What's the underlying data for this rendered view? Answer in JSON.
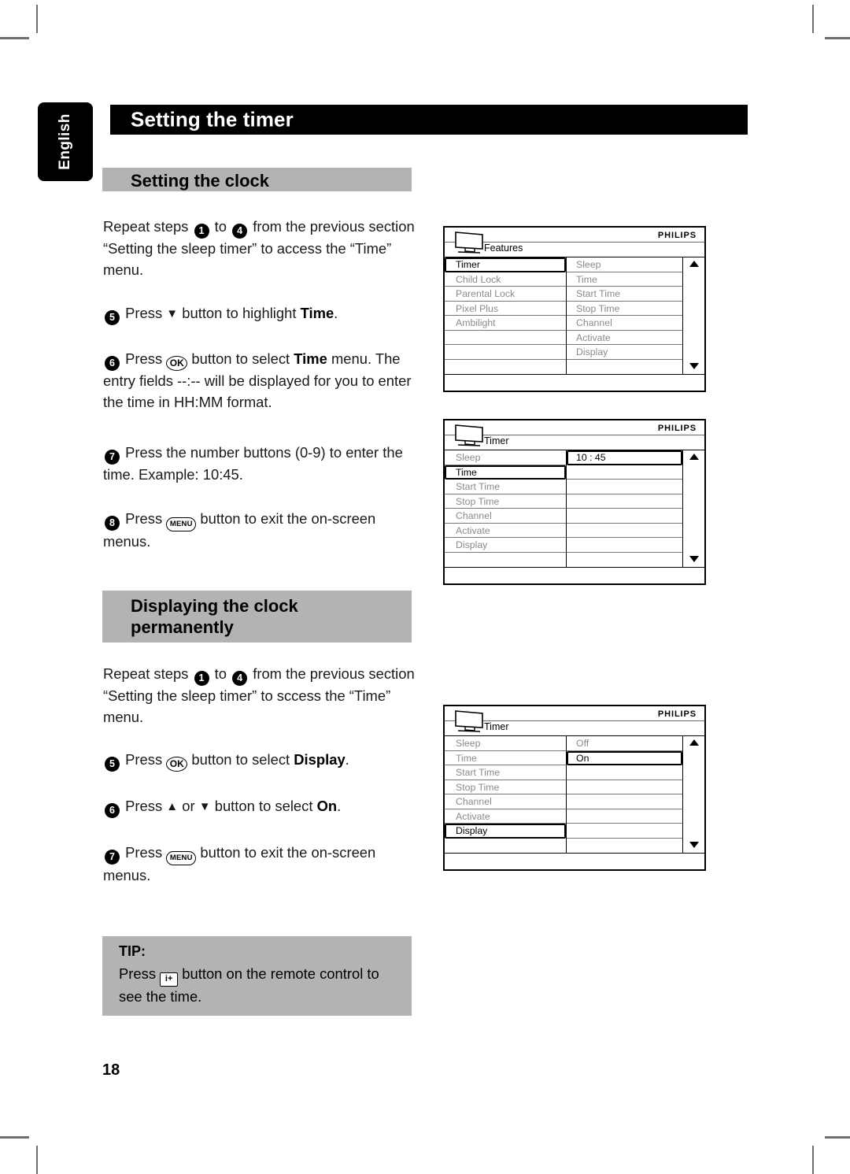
{
  "page": {
    "number": "18",
    "language_tab": "English",
    "chapter_title": "Setting the timer"
  },
  "sections": [
    {
      "heading": "Setting the clock",
      "paragraphs": [
        {
          "id": "p1",
          "text_pre": "Repeat steps",
          "step_a": "1",
          "mid": "to",
          "step_b": "4",
          "text_post": "from the previous section “Setting the sleep timer” to access the “Time” menu."
        },
        {
          "id": "p2",
          "step": "5",
          "pre": "Press",
          "glyph": "▼",
          "mid": "button to highlight",
          "bold": "Time",
          "post": "."
        },
        {
          "id": "p3",
          "step": "6",
          "pre": "Press",
          "glyph": "OK",
          "mid": "button to select",
          "bold": "Time",
          "post": " menu. The entry fields --:-- will be displayed for you to enter the time in HH:MM format."
        },
        {
          "id": "p4",
          "step": "7",
          "text": "Press the number buttons (0-9) to enter the time.  Example: 10:45."
        },
        {
          "id": "p5",
          "step": "8",
          "pre": "Press",
          "glyph": "MENU",
          "post": "button to exit the on-screen menus."
        }
      ]
    },
    {
      "heading": "Displaying the clock permanently",
      "paragraphs": [
        {
          "id": "p6",
          "text_pre": "Repeat steps",
          "step_a": "1",
          "mid": "to",
          "step_b": "4",
          "text_post": "from the previous section “Setting the sleep timer” to sccess the “Time” menu."
        },
        {
          "id": "p7",
          "step": "5",
          "pre": "Press",
          "glyph": "OK",
          "mid": "button to select",
          "bold": "Display",
          "post": "."
        },
        {
          "id": "p8",
          "step": "6",
          "pre": "Press",
          "glyph_a": "▲",
          "or": "or",
          "glyph_b": "▼",
          "mid": "button to select",
          "bold": "On",
          "post": "."
        },
        {
          "id": "p9",
          "step": "7",
          "pre": "Press",
          "glyph": "MENU",
          "post": "button to exit the on-screen menus."
        }
      ]
    }
  ],
  "tip": {
    "title": "TIP:",
    "pre": "Press",
    "glyph": "i+",
    "post": "button on the remote control to see the time."
  },
  "osd_menus": [
    {
      "id": "menu-features",
      "brand": "PHILIPS",
      "title": "Features",
      "left_items": [
        "Timer",
        "Child Lock",
        "Parental Lock",
        "Pixel Plus",
        "Ambilight",
        "",
        "",
        ""
      ],
      "left_selected_index": 0,
      "right_items": [
        "Sleep",
        "Time",
        "Start Time",
        "Stop Time",
        "Channel",
        "Activate",
        "Display",
        ""
      ],
      "right_selected_index": -1,
      "scroll_up": "▲",
      "scroll_down": "▼"
    },
    {
      "id": "menu-timer-time",
      "brand": "PHILIPS",
      "title": "Timer",
      "left_items": [
        "Sleep",
        "Time",
        "Start Time",
        "Stop Time",
        "Channel",
        "Activate",
        "Display",
        ""
      ],
      "left_selected_index": 1,
      "right_items": [
        "10 : 45",
        "",
        "",
        "",
        "",
        "",
        "",
        ""
      ],
      "right_selected_index": 0,
      "scroll_up": "▲",
      "scroll_down": "▼"
    },
    {
      "id": "menu-timer-display",
      "brand": "PHILIPS",
      "title": "Timer",
      "left_items": [
        "Sleep",
        "Time",
        "Start Time",
        "Stop Time",
        "Channel",
        "Activate",
        "Display",
        ""
      ],
      "left_selected_index": 6,
      "right_items": [
        "Off",
        "On",
        "",
        "",
        "",
        "",
        "",
        ""
      ],
      "right_selected_index": 1,
      "scroll_up": "▲",
      "scroll_down": "▼"
    }
  ],
  "colors": {
    "header_bg": "#000000",
    "section_bar_bg": "#b3b3b3",
    "dim_text": "#8a8a8a",
    "crop_mark": "#6e6e6e"
  }
}
